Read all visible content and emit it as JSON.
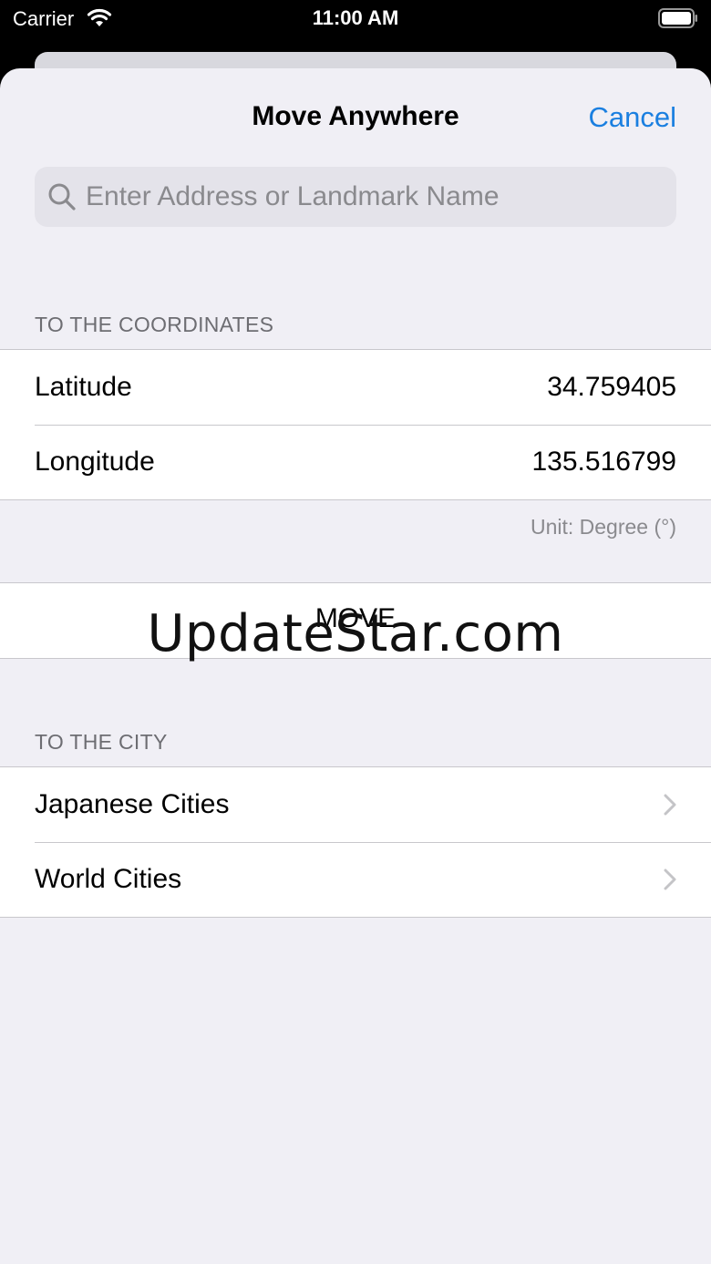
{
  "status_bar": {
    "carrier": "Carrier",
    "time": "11:00 AM"
  },
  "nav": {
    "title": "Move Anywhere",
    "cancel_label": "Cancel"
  },
  "search": {
    "placeholder": "Enter Address or Landmark Name",
    "value": ""
  },
  "coordinates": {
    "header": "TO THE COORDINATES",
    "latitude_label": "Latitude",
    "latitude_value": "34.759405",
    "longitude_label": "Longitude",
    "longitude_value": "135.516799",
    "unit_note": "Unit: Degree (°)"
  },
  "move_button": {
    "label": "MOVE"
  },
  "city": {
    "header": "TO THE CITY",
    "items": [
      {
        "label": "Japanese Cities"
      },
      {
        "label": "World Cities"
      }
    ]
  },
  "watermark": "UpdateStar.com",
  "colors": {
    "accent": "#1a7fe0",
    "background": "#f0eff5"
  }
}
